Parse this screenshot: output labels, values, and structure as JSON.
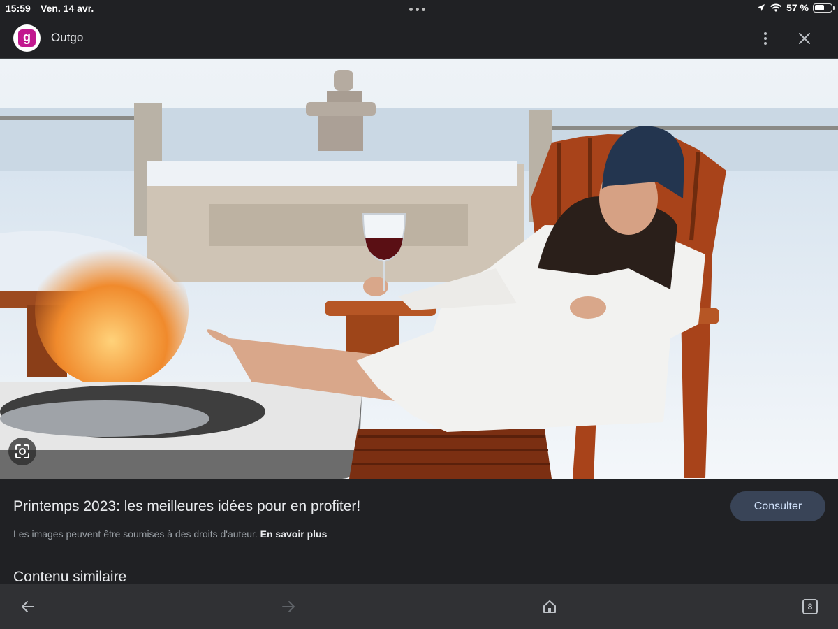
{
  "status_bar": {
    "time": "15:59",
    "date": "Ven. 14 avr.",
    "battery": "57 %",
    "battery_level": 0.57
  },
  "app_bar": {
    "site_logo_letter": "g",
    "site_name": "Outgo",
    "brand_color": "#c2188f"
  },
  "result": {
    "title": "Printemps 2023: les meilleures idées pour en profiter!",
    "copyright_notice": "Les images peuvent être soumises à des droits d'auteur.",
    "learn_more": "En savoir plus",
    "visit_label": "Consulter"
  },
  "related": {
    "heading": "Contenu similaire"
  },
  "toolbar": {
    "tab_count": "8"
  },
  "icons": [
    "more-vert-icon",
    "close-icon",
    "google-lens-icon",
    "back-arrow-icon",
    "forward-arrow-icon",
    "home-icon",
    "tab-switcher-icon",
    "location-arrow-icon",
    "wifi-icon",
    "battery-icon"
  ]
}
